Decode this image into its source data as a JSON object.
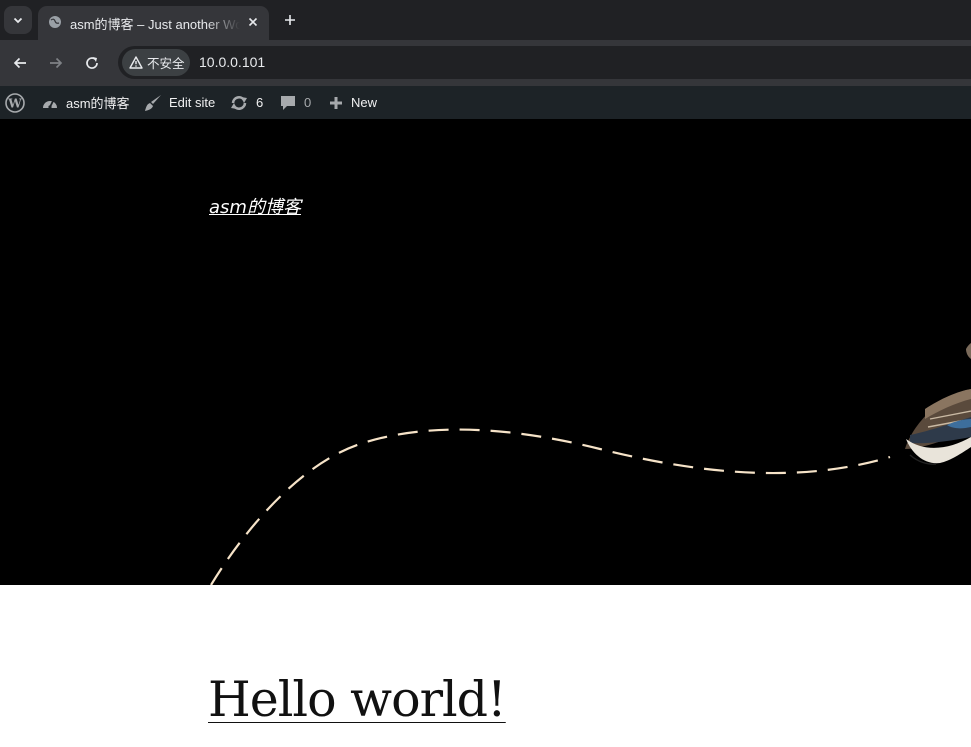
{
  "browser": {
    "tab": {
      "title": "asm的博客 – Just another WordPress site",
      "favicon": "globe-icon"
    },
    "address_bar": {
      "security_label": "不安全",
      "url": "10.0.0.101"
    }
  },
  "admin_bar": {
    "wp_logo": "wordpress-logo-icon",
    "site_name": "asm的博客",
    "edit_site": "Edit site",
    "updates_count": "6",
    "comments_count": "0",
    "new_label": "New"
  },
  "hero": {
    "site_title": "asm的博客",
    "illustration": "bird-flight-path"
  },
  "post": {
    "title": "Hello world!"
  },
  "colors": {
    "tabstrip_bg": "#202124",
    "toolbar_bg": "#35363a",
    "adminbar_bg": "#1d2327",
    "hero_bg": "#000000",
    "flight_path": "#f6e3c8"
  }
}
